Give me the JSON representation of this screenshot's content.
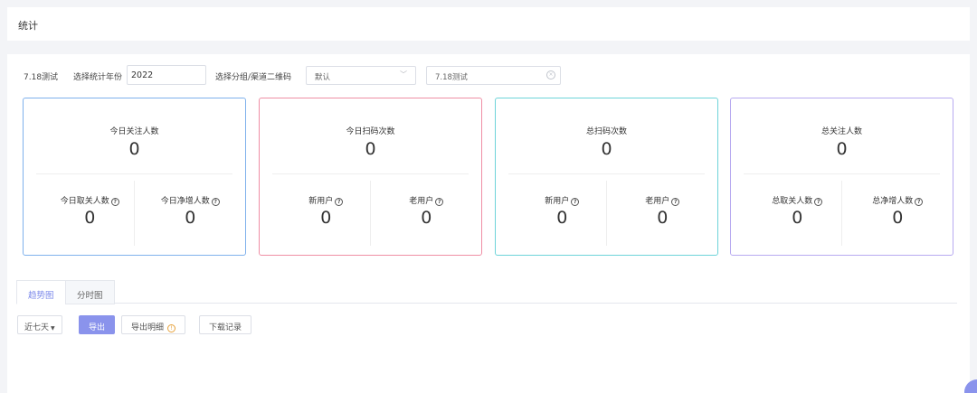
{
  "header": {
    "title": "统计"
  },
  "filters": {
    "test_label": "7.18测试",
    "year_label": "选择统计年份",
    "year_value": "2022",
    "group_label": "选择分组/渠道二维码",
    "group_value": "默认",
    "channel_value": "7.18测试"
  },
  "cards": [
    {
      "title": "今日关注人数",
      "value": "0",
      "left_label": "今日取关人数",
      "left_value": "0",
      "right_label": "今日净增人数",
      "right_value": "0"
    },
    {
      "title": "今日扫码次数",
      "value": "0",
      "left_label": "新用户",
      "left_value": "0",
      "right_label": "老用户",
      "right_value": "0"
    },
    {
      "title": "总扫码次数",
      "value": "0",
      "left_label": "新用户",
      "left_value": "0",
      "right_label": "老用户",
      "right_value": "0"
    },
    {
      "title": "总关注人数",
      "value": "0",
      "left_label": "总取关人数",
      "left_value": "0",
      "right_label": "总净增人数",
      "right_value": "0"
    }
  ],
  "card_colors": [
    "#7fb1ec",
    "#ef8ea5",
    "#6ed4d9",
    "#b7aaf0"
  ],
  "tabs": [
    {
      "label": "趋势图",
      "active": true
    },
    {
      "label": "分时图",
      "active": false
    }
  ],
  "toolbar": {
    "range_label": "近七天",
    "export_label": "导出",
    "export_detail_label": "导出明细",
    "download_label": "下载记录"
  },
  "icons": {
    "help": "question-circle-icon",
    "warning": "warning-circle-icon",
    "clear": "clear-circle-icon",
    "chevron": "chevron-down-icon"
  },
  "accent_color": "#8a93ec"
}
